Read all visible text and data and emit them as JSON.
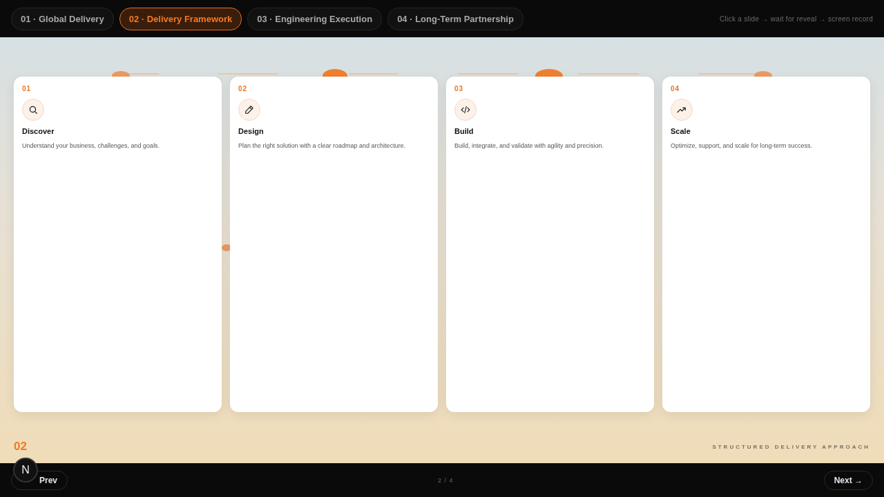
{
  "tabs": [
    {
      "label": "01 · Global Delivery",
      "selected": false
    },
    {
      "label": "02 · Delivery Framework",
      "selected": true
    },
    {
      "label": "03 · Engineering Execution",
      "selected": false
    },
    {
      "label": "04 · Long-Term Partnership",
      "selected": false
    }
  ],
  "hint": "Click a slide → wait for reveal → screen record",
  "steps": [
    {
      "number": "01",
      "title": "Discover",
      "text": "Understand your business, challenges, and goals."
    },
    {
      "number": "02",
      "title": "Design",
      "text": "Plan the right solution with a clear roadmap and architecture."
    },
    {
      "number": "03",
      "title": "Build",
      "text": "Build, integrate, and validate with agility and precision."
    },
    {
      "number": "04",
      "title": "Scale",
      "text": "Optimize, support, and scale for long-term success."
    }
  ],
  "slide_number": "02",
  "slide_caption": "STRUCTURED DELIVERY APPROACH",
  "footer": {
    "badge": "N",
    "prev": "Prev",
    "page": "2 / 4",
    "next": "Next →"
  }
}
